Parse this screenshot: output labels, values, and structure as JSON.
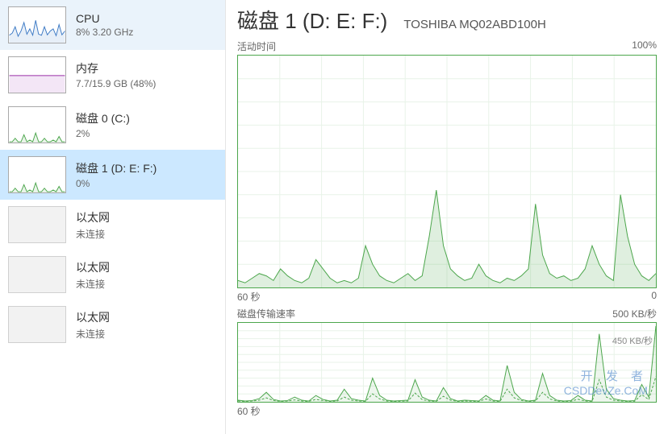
{
  "sidebar": {
    "items": [
      {
        "title": "CPU",
        "sub": "8%  3.20 GHz",
        "color": "#3a78c4",
        "type": "cpu"
      },
      {
        "title": "内存",
        "sub": "7.7/15.9 GB (48%)",
        "color": "#9a2fa8",
        "type": "mem"
      },
      {
        "title": "磁盘 0 (C:)",
        "sub": "2%",
        "color": "#4ca64c",
        "type": "disk"
      },
      {
        "title": "磁盘 1 (D: E: F:)",
        "sub": "0%",
        "color": "#4ca64c",
        "type": "disk",
        "selected": true
      },
      {
        "title": "以太网",
        "sub": "未连接",
        "type": "eth"
      },
      {
        "title": "以太网",
        "sub": "未连接",
        "type": "eth"
      },
      {
        "title": "以太网",
        "sub": "未连接",
        "type": "eth"
      }
    ]
  },
  "main": {
    "title": "磁盘 1 (D: E: F:)",
    "subtitle": "TOSHIBA MQ02ABD100H",
    "chart1": {
      "label_left": "活动时间",
      "label_right": "100%",
      "xaxis_left": "60 秒",
      "xaxis_right": "0"
    },
    "chart2": {
      "label_left": "磁盘传输速率",
      "label_right": "500 KB/秒",
      "inner_label": "450 KB/秒",
      "xaxis_left": "60 秒"
    }
  },
  "watermark": {
    "line1": "开 发 者",
    "line2": "CSDDevZe.CoM"
  },
  "chart_data": {
    "type": "area",
    "activity": {
      "ylabel": "活动时间",
      "ylim": [
        0,
        100
      ],
      "xlabel_left": "60 秒",
      "xlabel_right": "0",
      "values": [
        3,
        2,
        4,
        6,
        5,
        3,
        8,
        5,
        3,
        2,
        4,
        12,
        8,
        4,
        2,
        3,
        2,
        4,
        18,
        10,
        5,
        3,
        2,
        4,
        6,
        3,
        5,
        22,
        42,
        18,
        8,
        5,
        3,
        4,
        10,
        5,
        3,
        2,
        4,
        3,
        5,
        8,
        36,
        14,
        6,
        4,
        5,
        3,
        4,
        8,
        18,
        10,
        5,
        3,
        40,
        22,
        10,
        5,
        3,
        6
      ]
    },
    "transfer": {
      "ylabel": "磁盘传输速率",
      "ylim": [
        0,
        500
      ],
      "unit": "KB/秒",
      "read": [
        10,
        5,
        8,
        20,
        60,
        15,
        5,
        8,
        30,
        10,
        5,
        40,
        15,
        5,
        10,
        80,
        20,
        10,
        5,
        150,
        40,
        10,
        5,
        8,
        10,
        140,
        30,
        10,
        5,
        90,
        20,
        5,
        10,
        8,
        5,
        40,
        10,
        5,
        230,
        60,
        15,
        5,
        10,
        180,
        40,
        10,
        5,
        8,
        40,
        10,
        5,
        430,
        80,
        20,
        10,
        5,
        8,
        110,
        30,
        480
      ],
      "write": [
        5,
        3,
        5,
        10,
        25,
        8,
        3,
        5,
        12,
        5,
        3,
        15,
        8,
        3,
        5,
        30,
        10,
        5,
        3,
        50,
        18,
        5,
        3,
        4,
        5,
        55,
        14,
        5,
        3,
        35,
        10,
        3,
        5,
        4,
        3,
        18,
        5,
        3,
        80,
        25,
        8,
        3,
        5,
        60,
        18,
        5,
        3,
        4,
        16,
        5,
        3,
        140,
        30,
        10,
        5,
        3,
        4,
        45,
        14,
        160
      ]
    }
  }
}
